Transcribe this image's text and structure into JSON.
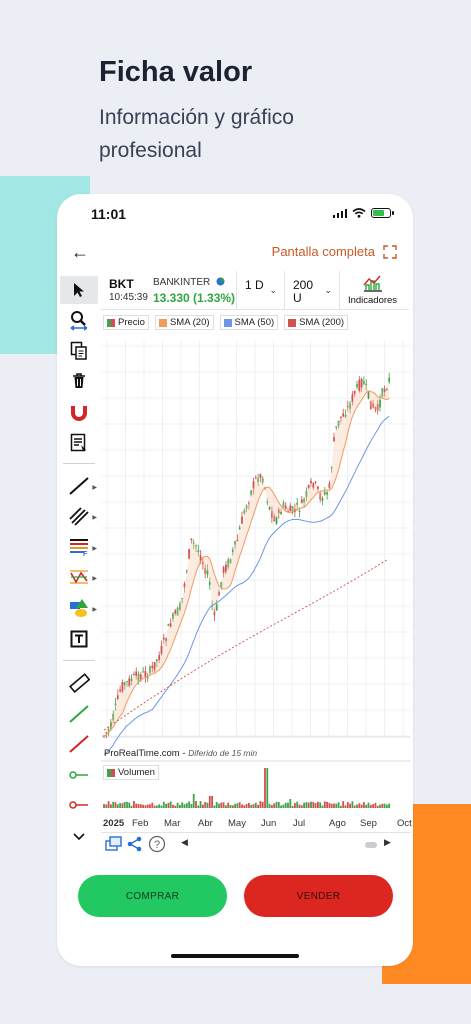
{
  "promo": {
    "title": "Ficha valor",
    "subtitle": "Información y gráfico profesional"
  },
  "status_bar": {
    "time": "11:01"
  },
  "nav": {
    "fullscreen_label": "Pantalla completa"
  },
  "instrument": {
    "ticker": "BKT",
    "time": "10:45:39",
    "company": "BANKINTER",
    "price": "13.330 (1.33%)",
    "price_color": "#2ea73f"
  },
  "controls": {
    "timeframe": "1 D",
    "bars": "200 U",
    "indicators_label": "Indicadores"
  },
  "legend": [
    {
      "label": "Precio",
      "color": "#3ea34a"
    },
    {
      "label": "SMA (20)",
      "color": "#f29a5e"
    },
    {
      "label": "SMA (50)",
      "color": "#6e96e6"
    },
    {
      "label": "SMA (200)",
      "color": "#d2504e"
    }
  ],
  "chart": {
    "watermark": "ProRealTime.com",
    "delay_note": "Diferido de 15 min",
    "volume_label": "Volumen",
    "x_labels": [
      "2025",
      "Feb",
      "Mar",
      "Abr",
      "May",
      "Jun",
      "Jul",
      "Ago",
      "Sep",
      "Oct"
    ]
  },
  "toolbar_icons": [
    "cursor-icon",
    "zoom-icon",
    "copy-icon",
    "trash-icon",
    "magnet-icon",
    "edit-list-icon",
    "trend-line-icon",
    "parallel-lines-icon",
    "fibonacci-icon",
    "zigzag-icon",
    "shapes-icon",
    "text-tool-icon",
    "ruler-icon",
    "green-line-icon",
    "red-line-icon",
    "green-marker-icon",
    "red-marker-icon",
    "collapse-icon"
  ],
  "actions": {
    "buy_label": "COMPRAR",
    "sell_label": "VENDER",
    "buy_color": "#22c861",
    "sell_color": "#dc2620"
  }
}
